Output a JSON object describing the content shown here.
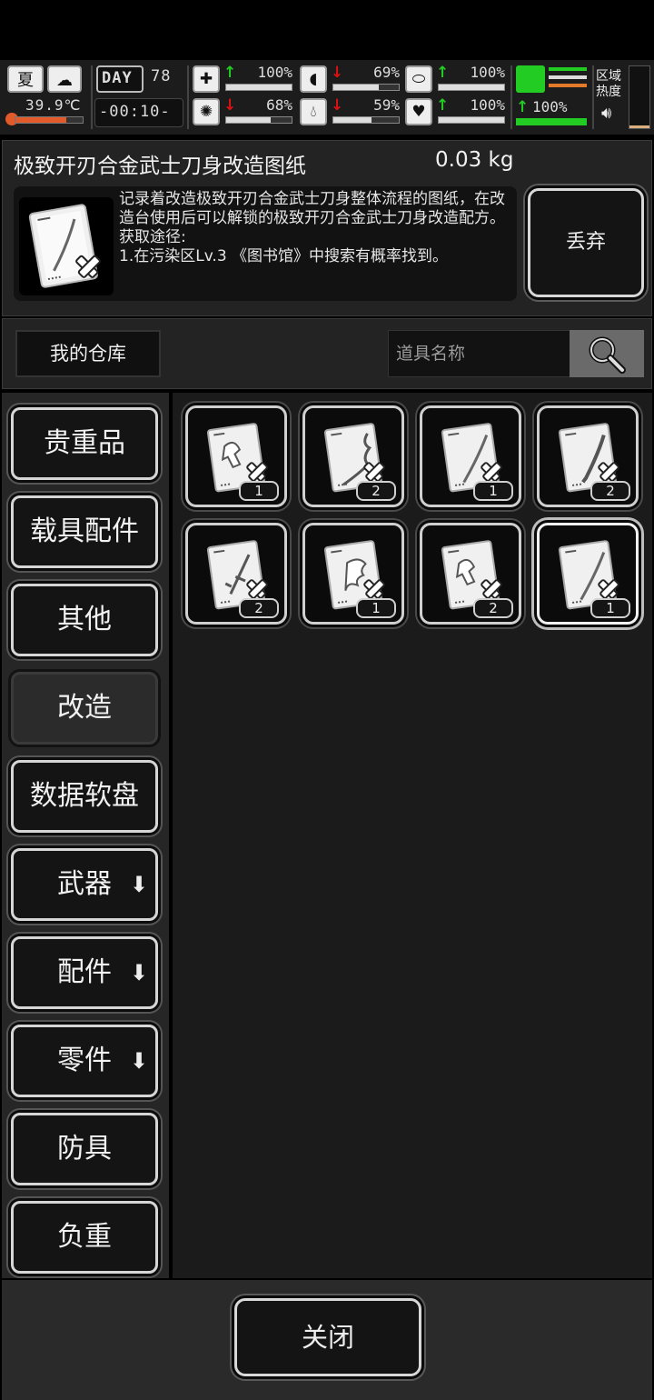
{
  "status": {
    "season": "夏",
    "season_icon": "summer-sun-icon",
    "weather_icon": "cloudy-night-icon",
    "temperature": "39.9℃",
    "temperature_level": 0.75,
    "day_label": "DAY",
    "day_number": "78",
    "time": "-00:10-",
    "stats": [
      {
        "icon": "medkit-icon",
        "trend": "up",
        "value": "100%",
        "level": 1.0
      },
      {
        "icon": "stomach-icon",
        "trend": "down",
        "value": "69%",
        "level": 0.69
      },
      {
        "icon": "capsule-icon",
        "trend": "up",
        "value": "100%",
        "level": 1.0
      },
      {
        "icon": "brain-icon",
        "trend": "down",
        "value": "68%",
        "level": 0.68
      },
      {
        "icon": "water-drop-icon",
        "trend": "down",
        "value": "59%",
        "level": 0.59
      },
      {
        "icon": "heart-icon",
        "trend": "up",
        "value": "100%",
        "level": 1.0
      }
    ],
    "stamina": {
      "icon": "running-icon",
      "trend": "up",
      "value": "100%",
      "level": 1.0,
      "color": "#22cc22"
    },
    "region_heat_label_1": "区域",
    "region_heat_label_2": "热度",
    "region_heat_level": 0.05
  },
  "item": {
    "name": "极致开刃合金武士刀身改造图纸",
    "weight": "0.03 kg",
    "description": "记录着改造极致开刃合金武士刀身整体流程的图纸，在改造台使用后可以解锁的极致开刃合金武士刀身改造配方。\n获取途径:\n1.在污染区Lv.3 《图书馆》中搜索有概率找到。",
    "icon": "blueprint-katana-icon",
    "discard_label": "丢弃"
  },
  "search": {
    "warehouse_label": "我的仓库",
    "placeholder": "道具名称",
    "button_icon": "search-icon"
  },
  "categories": [
    {
      "label": "贵重品",
      "has_submenu": false,
      "active": false
    },
    {
      "label": "载具配件",
      "has_submenu": false,
      "active": false
    },
    {
      "label": "其他",
      "has_submenu": false,
      "active": false
    },
    {
      "label": "改造",
      "has_submenu": false,
      "active": true
    },
    {
      "label": "数据软盘",
      "has_submenu": false,
      "active": false
    },
    {
      "label": "武器",
      "has_submenu": true,
      "active": false
    },
    {
      "label": "配件",
      "has_submenu": true,
      "active": false
    },
    {
      "label": "零件",
      "has_submenu": true,
      "active": false
    },
    {
      "label": "防具",
      "has_submenu": false,
      "active": false
    },
    {
      "label": "负重",
      "has_submenu": false,
      "active": false
    }
  ],
  "grid_items": [
    {
      "icon": "blueprint-trigger-icon",
      "count": "1",
      "selected": false
    },
    {
      "icon": "blueprint-whip-icon",
      "count": "2",
      "selected": false
    },
    {
      "icon": "blueprint-katana-icon",
      "count": "1",
      "selected": false
    },
    {
      "icon": "blueprint-blade-icon",
      "count": "2",
      "selected": false
    },
    {
      "icon": "blueprint-rifle-icon",
      "count": "2",
      "selected": false
    },
    {
      "icon": "blueprint-claw-icon",
      "count": "1",
      "selected": false
    },
    {
      "icon": "blueprint-trigger-icon",
      "count": "2",
      "selected": false
    },
    {
      "icon": "blueprint-katana-icon",
      "count": "1",
      "selected": true
    }
  ],
  "footer": {
    "close_label": "关闭"
  },
  "colors": {
    "panel": "#232323",
    "button_border": "#d8d8d8",
    "up_arrow": "#22cc22",
    "down_arrow": "#dd1111",
    "temperature_bar": "#e25a2a"
  }
}
